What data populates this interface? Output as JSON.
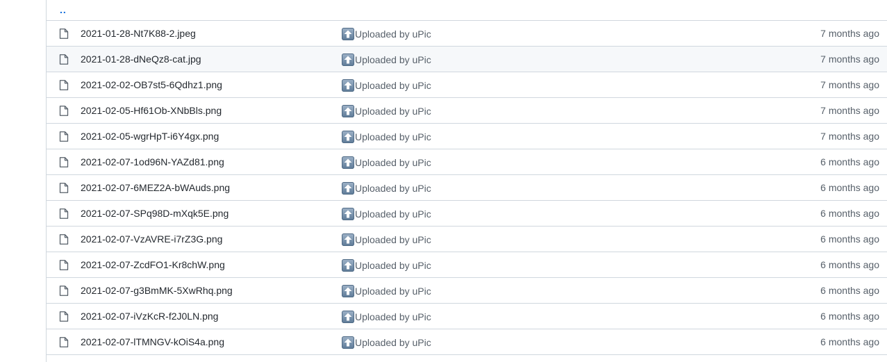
{
  "parent_dir": {
    "label": ".."
  },
  "commit_label": "Uploaded by uPic",
  "colors": {
    "link": "#0969da",
    "border": "#d0d7de",
    "muted": "#57606a"
  },
  "icons": {
    "file": "file-icon",
    "commit": "up-arrow-emoji-icon"
  },
  "files": [
    {
      "name": "2021-01-28-Nt7K88-2.jpeg",
      "commit": "Uploaded by uPic",
      "age": "7 months ago"
    },
    {
      "name": "2021-01-28-dNeQz8-cat.jpg",
      "commit": "Uploaded by uPic",
      "age": "7 months ago"
    },
    {
      "name": "2021-02-02-OB7st5-6Qdhz1.png",
      "commit": "Uploaded by uPic",
      "age": "7 months ago"
    },
    {
      "name": "2021-02-05-Hf61Ob-XNbBls.png",
      "commit": "Uploaded by uPic",
      "age": "7 months ago"
    },
    {
      "name": "2021-02-05-wgrHpT-i6Y4gx.png",
      "commit": "Uploaded by uPic",
      "age": "7 months ago"
    },
    {
      "name": "2021-02-07-1od96N-YAZd81.png",
      "commit": "Uploaded by uPic",
      "age": "6 months ago"
    },
    {
      "name": "2021-02-07-6MEZ2A-bWAuds.png",
      "commit": "Uploaded by uPic",
      "age": "6 months ago"
    },
    {
      "name": "2021-02-07-SPq98D-mXqk5E.png",
      "commit": "Uploaded by uPic",
      "age": "6 months ago"
    },
    {
      "name": "2021-02-07-VzAVRE-i7rZ3G.png",
      "commit": "Uploaded by uPic",
      "age": "6 months ago"
    },
    {
      "name": "2021-02-07-ZcdFO1-Kr8chW.png",
      "commit": "Uploaded by uPic",
      "age": "6 months ago"
    },
    {
      "name": "2021-02-07-g3BmMK-5XwRhq.png",
      "commit": "Uploaded by uPic",
      "age": "6 months ago"
    },
    {
      "name": "2021-02-07-iVzKcR-f2J0LN.png",
      "commit": "Uploaded by uPic",
      "age": "6 months ago"
    },
    {
      "name": "2021-02-07-lTMNGV-kOiS4a.png",
      "commit": "Uploaded by uPic",
      "age": "6 months ago"
    }
  ]
}
